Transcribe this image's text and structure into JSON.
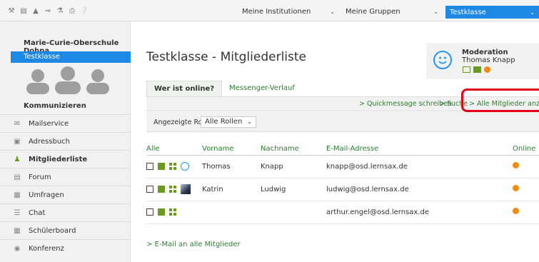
{
  "topbar": {
    "icons": [
      "tools-icon",
      "document-icon",
      "bookmark-icon",
      "logout-icon",
      "keys-icon",
      "print-icon",
      "help-icon"
    ],
    "institutions_select": "Meine Institutionen",
    "groups_select": "Meine Gruppen",
    "class_select": "Testklasse"
  },
  "sidebar": {
    "school": "Marie-Curie-Oberschule Dohna",
    "class": "Testklasse",
    "section": "Kommunizieren",
    "items": [
      {
        "label": "Mailservice",
        "icon": "mail-icon"
      },
      {
        "label": "Adressbuch",
        "icon": "addressbook-icon"
      },
      {
        "label": "Mitgliederliste",
        "icon": "members-icon"
      },
      {
        "label": "Forum",
        "icon": "forum-icon"
      },
      {
        "label": "Umfragen",
        "icon": "poll-icon"
      },
      {
        "label": "Chat",
        "icon": "chat-icon"
      },
      {
        "label": "Schülerboard",
        "icon": "board-icon"
      },
      {
        "label": "Konferenz",
        "icon": "conference-icon"
      }
    ]
  },
  "main": {
    "title": "Testklasse - Mitgliederliste",
    "moderation": {
      "label": "Moderation",
      "name": "Thomas Knapp"
    },
    "tabs": [
      {
        "label": "Wer ist online?"
      },
      {
        "label": "Messenger-Verlauf"
      }
    ],
    "actions": [
      "> Quickmessage schreiben",
      "> Suche",
      "> Alle Mitglieder anzeigen"
    ],
    "filter": {
      "label": "Angezeigte Rolle",
      "value": "Alle Rollen"
    },
    "table": {
      "headers": [
        "Alle",
        "Vorname",
        "Nachname",
        "E-Mail-Adresse",
        "Online"
      ],
      "rows": [
        {
          "first": "Thomas",
          "last": "Knapp",
          "email": "knapp@osd.lernsax.de",
          "avatar": "smiley"
        },
        {
          "first": "Katrin",
          "last": "Ludwig",
          "email": "ludwig@osd.lernsax.de",
          "avatar": "photo"
        },
        {
          "first": "",
          "last": "",
          "email": "arthur.engel@osd.lernsax.de",
          "avatar": "none"
        }
      ]
    },
    "email_all": "> E-Mail an alle Mitglieder"
  },
  "colors": {
    "accent_blue": "#1e88e5",
    "link_green": "#2e7d32",
    "icon_green": "#6a9a1e",
    "online_orange": "#f08a10",
    "highlight_red": "#e3001b"
  }
}
